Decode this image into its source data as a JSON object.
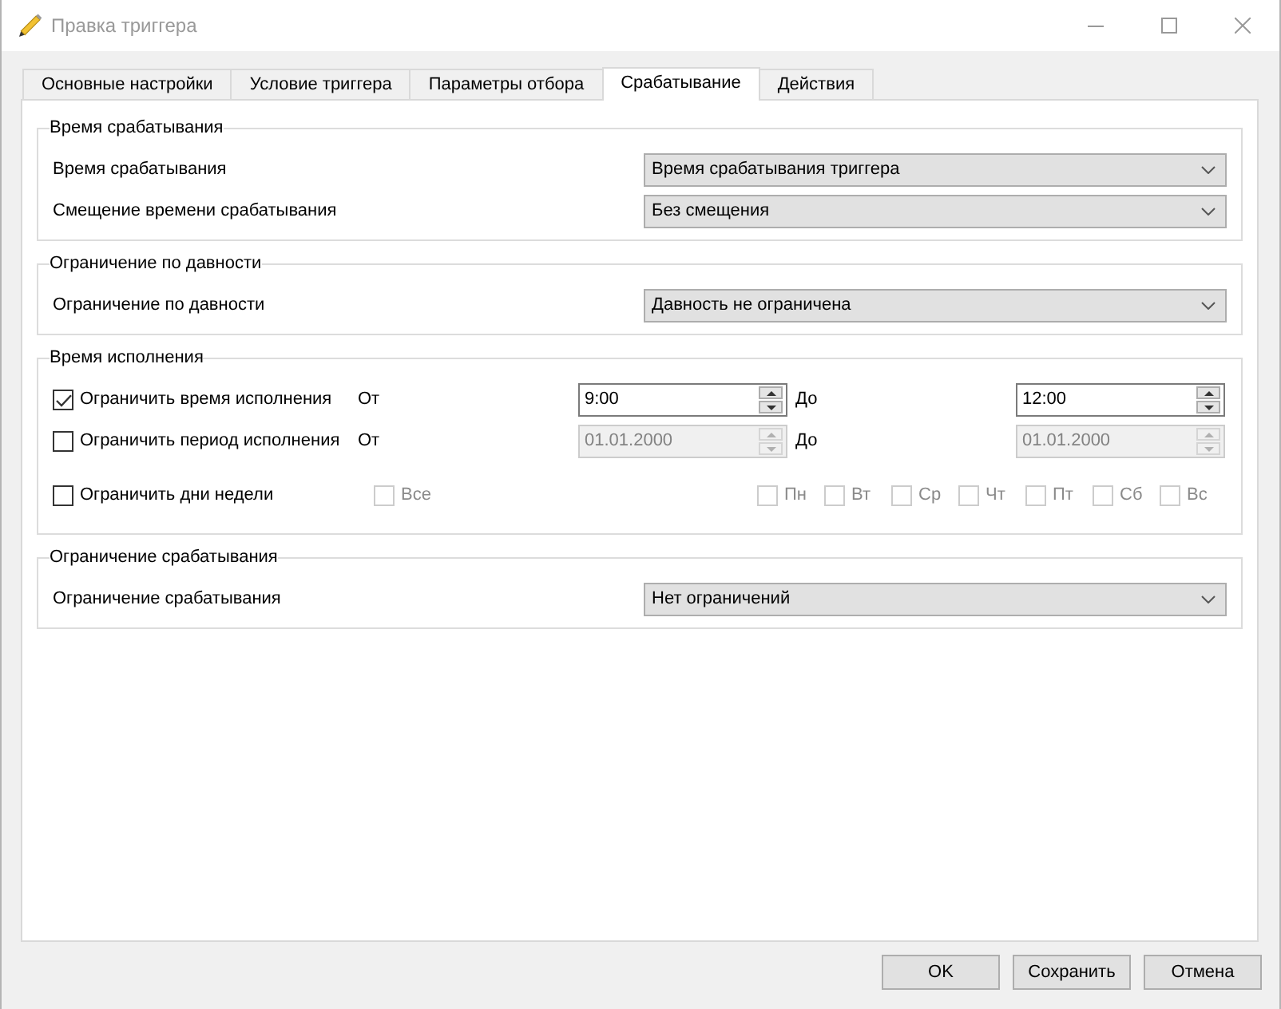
{
  "window": {
    "title": "Правка триггера"
  },
  "tabs": [
    {
      "label": "Основные настройки",
      "selected": false
    },
    {
      "label": "Условие триггера",
      "selected": false
    },
    {
      "label": "Параметры отбора",
      "selected": false
    },
    {
      "label": "Срабатывание",
      "selected": true
    },
    {
      "label": "Действия",
      "selected": false
    }
  ],
  "groups": [
    {
      "title": "Время срабатывания",
      "rows": [
        {
          "kind": "dropdown",
          "label": "Время срабатывания",
          "value": "Время срабатывания триггера"
        },
        {
          "kind": "dropdown",
          "label": "Смещение времени срабатывания",
          "value": "Без смещения"
        }
      ]
    },
    {
      "title": "Ограничение по давности",
      "rows": [
        {
          "kind": "dropdown",
          "label": "Ограничение по давности",
          "value": "Давность не ограничена"
        }
      ]
    },
    {
      "title": "Время исполнения",
      "rows": [
        {
          "kind": "range",
          "label": "Ограничить время исполнения",
          "checked": true,
          "from_label": "От",
          "from": {
            "value": "9:00",
            "disabled": false
          },
          "to_label": "До",
          "to": {
            "value": "12:00",
            "disabled": false
          }
        },
        {
          "kind": "range",
          "label": "Ограничить период исполнения",
          "checked": false,
          "from_label": "От",
          "from": {
            "value": "01.01.2000",
            "disabled": true
          },
          "to_label": "До",
          "to": {
            "value": "01.01.2000",
            "disabled": true
          }
        },
        {
          "kind": "weekdays",
          "label": "Ограничить дни недели",
          "checked": false,
          "all": {
            "label": "Все",
            "checked": false,
            "disabled": true
          },
          "days": [
            {
              "label": "Пн",
              "checked": false,
              "disabled": true
            },
            {
              "label": "Вт",
              "checked": false,
              "disabled": true
            },
            {
              "label": "Ср",
              "checked": false,
              "disabled": true
            },
            {
              "label": "Чт",
              "checked": false,
              "disabled": true
            },
            {
              "label": "Пт",
              "checked": false,
              "disabled": true
            },
            {
              "label": "Сб",
              "checked": false,
              "disabled": true
            },
            {
              "label": "Вс",
              "checked": false,
              "disabled": true
            }
          ]
        }
      ]
    },
    {
      "title": "Ограничение срабатывания",
      "rows": [
        {
          "kind": "dropdown",
          "label": "Ограничение срабатывания",
          "value": "Нет ограничений"
        }
      ]
    }
  ],
  "buttons": [
    "OK",
    "Сохранить",
    "Отмена"
  ]
}
